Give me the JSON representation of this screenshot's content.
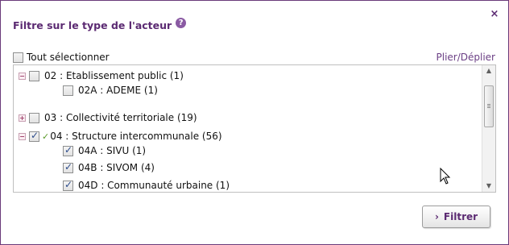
{
  "dialog": {
    "title": "Filtre sur le type de l'acteur",
    "help_icon": "?",
    "close_icon": "×",
    "select_all_label": "Tout sélectionner",
    "fold_link": "Plier/Déplier",
    "filter_button": "Filtrer",
    "filter_chevron": "›"
  },
  "tree": [
    {
      "toggle": "−",
      "checked": false,
      "label": "02 : Etablissement public (1)"
    },
    {
      "checked": false,
      "label": "02A : ADEME (1)"
    },
    {
      "toggle": "+",
      "checked": false,
      "label": "03 : Collectivité territoriale (19)"
    },
    {
      "toggle": "−",
      "checked": true,
      "partial_tick": "✓",
      "label": "04 : Structure intercommunale (56)"
    },
    {
      "checked": true,
      "label": "04A : SIVU (1)"
    },
    {
      "checked": true,
      "label": "04B : SIVOM (4)"
    },
    {
      "checked": true,
      "label": "04D : Communauté urbaine (1)"
    }
  ],
  "scrollbar": {
    "up_arrow": "▲",
    "down_arrow": "▼"
  }
}
